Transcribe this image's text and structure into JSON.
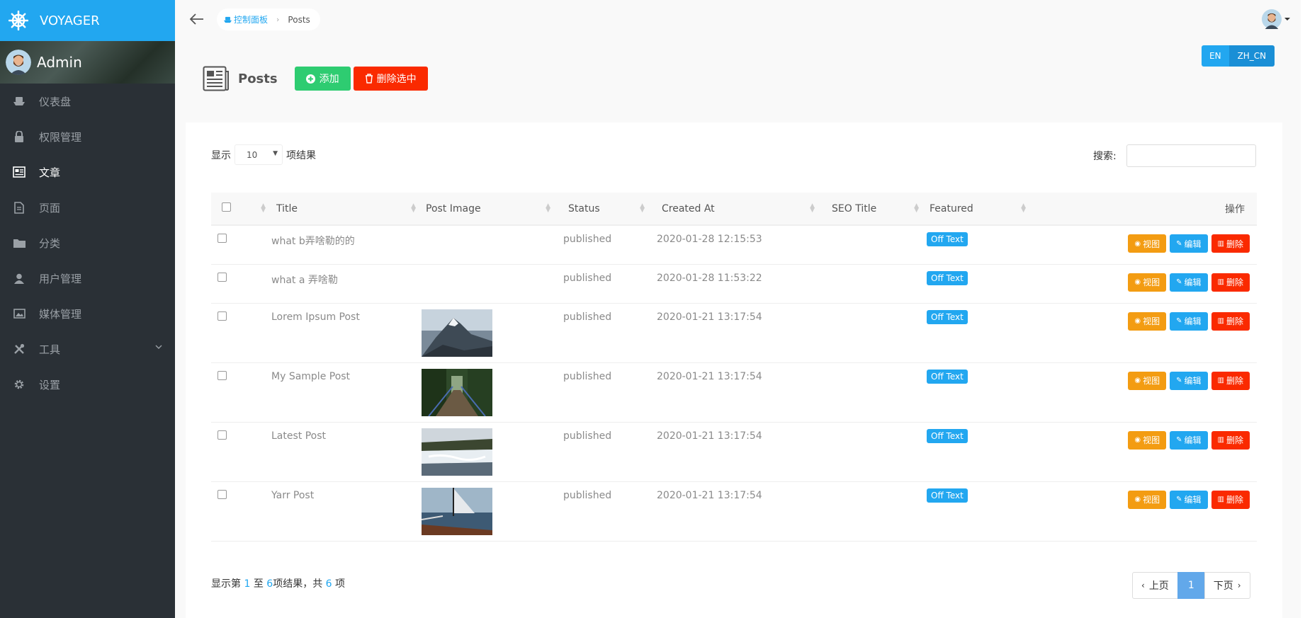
{
  "brand": {
    "name": "VOYAGER",
    "icon": "helm-icon"
  },
  "profile": {
    "name": "Admin"
  },
  "sidebar": {
    "items": [
      {
        "label": "仪表盘",
        "icon": "boat-icon"
      },
      {
        "label": "权限管理",
        "icon": "lock-icon"
      },
      {
        "label": "文章",
        "icon": "news-icon"
      },
      {
        "label": "页面",
        "icon": "file-icon"
      },
      {
        "label": "分类",
        "icon": "folder-icon"
      },
      {
        "label": "用户管理",
        "icon": "person-icon"
      },
      {
        "label": "媒体管理",
        "icon": "images-icon"
      },
      {
        "label": "工具",
        "icon": "tools-icon"
      },
      {
        "label": "设置",
        "icon": "gear-icon"
      }
    ],
    "active": "文章"
  },
  "breadcrumb": {
    "home": "控制面板",
    "current": "Posts"
  },
  "lang": {
    "en": "EN",
    "zh": "ZH_CN",
    "active": "ZH_CN"
  },
  "page": {
    "title": "Posts",
    "add_label": "添加",
    "bulk_delete_label": "删除选中"
  },
  "table_controls": {
    "show_prefix": "显示",
    "page_length": "10",
    "show_suffix": "项结果",
    "search_label": "搜索:",
    "search_value": ""
  },
  "table": {
    "columns": [
      "Title",
      "Post Image",
      "Status",
      "Created At",
      "SEO Title",
      "Featured",
      "操作"
    ],
    "rows": [
      {
        "title": "what b弄啥勒的的",
        "image": "",
        "status": "published",
        "created": "2020-01-28 12:15:53",
        "seo": "",
        "featured": "Off Text"
      },
      {
        "title": "what a 弄啥勒",
        "image": "",
        "status": "published",
        "created": "2020-01-28 11:53:22",
        "seo": "",
        "featured": "Off Text"
      },
      {
        "title": "Lorem Ipsum Post",
        "image": "mountain",
        "status": "published",
        "created": "2020-01-21 13:17:54",
        "seo": "",
        "featured": "Off Text"
      },
      {
        "title": "My Sample Post",
        "image": "bridge",
        "status": "published",
        "created": "2020-01-21 13:17:54",
        "seo": "",
        "featured": "Off Text"
      },
      {
        "title": "Latest Post",
        "image": "waterfall",
        "status": "published",
        "created": "2020-01-21 13:17:54",
        "seo": "",
        "featured": "Off Text"
      },
      {
        "title": "Yarr Post",
        "image": "sailboat",
        "status": "published",
        "created": "2020-01-21 13:17:54",
        "seo": "",
        "featured": "Off Text"
      }
    ],
    "actions": {
      "view": "视图",
      "edit": "编辑",
      "delete": "删除"
    }
  },
  "footer": {
    "info_a": "显示第",
    "from": "1",
    "info_b": "至",
    "to": "6",
    "info_c": "项结果，共",
    "total": "6",
    "info_d": "项"
  },
  "pagination": {
    "prev": "上页",
    "current": "1",
    "next": "下页"
  },
  "colors": {
    "accent": "#22a7f0",
    "success": "#2ecc71",
    "danger": "#fa2a00",
    "warning": "#f39c12",
    "sidebar": "#2a3036"
  }
}
